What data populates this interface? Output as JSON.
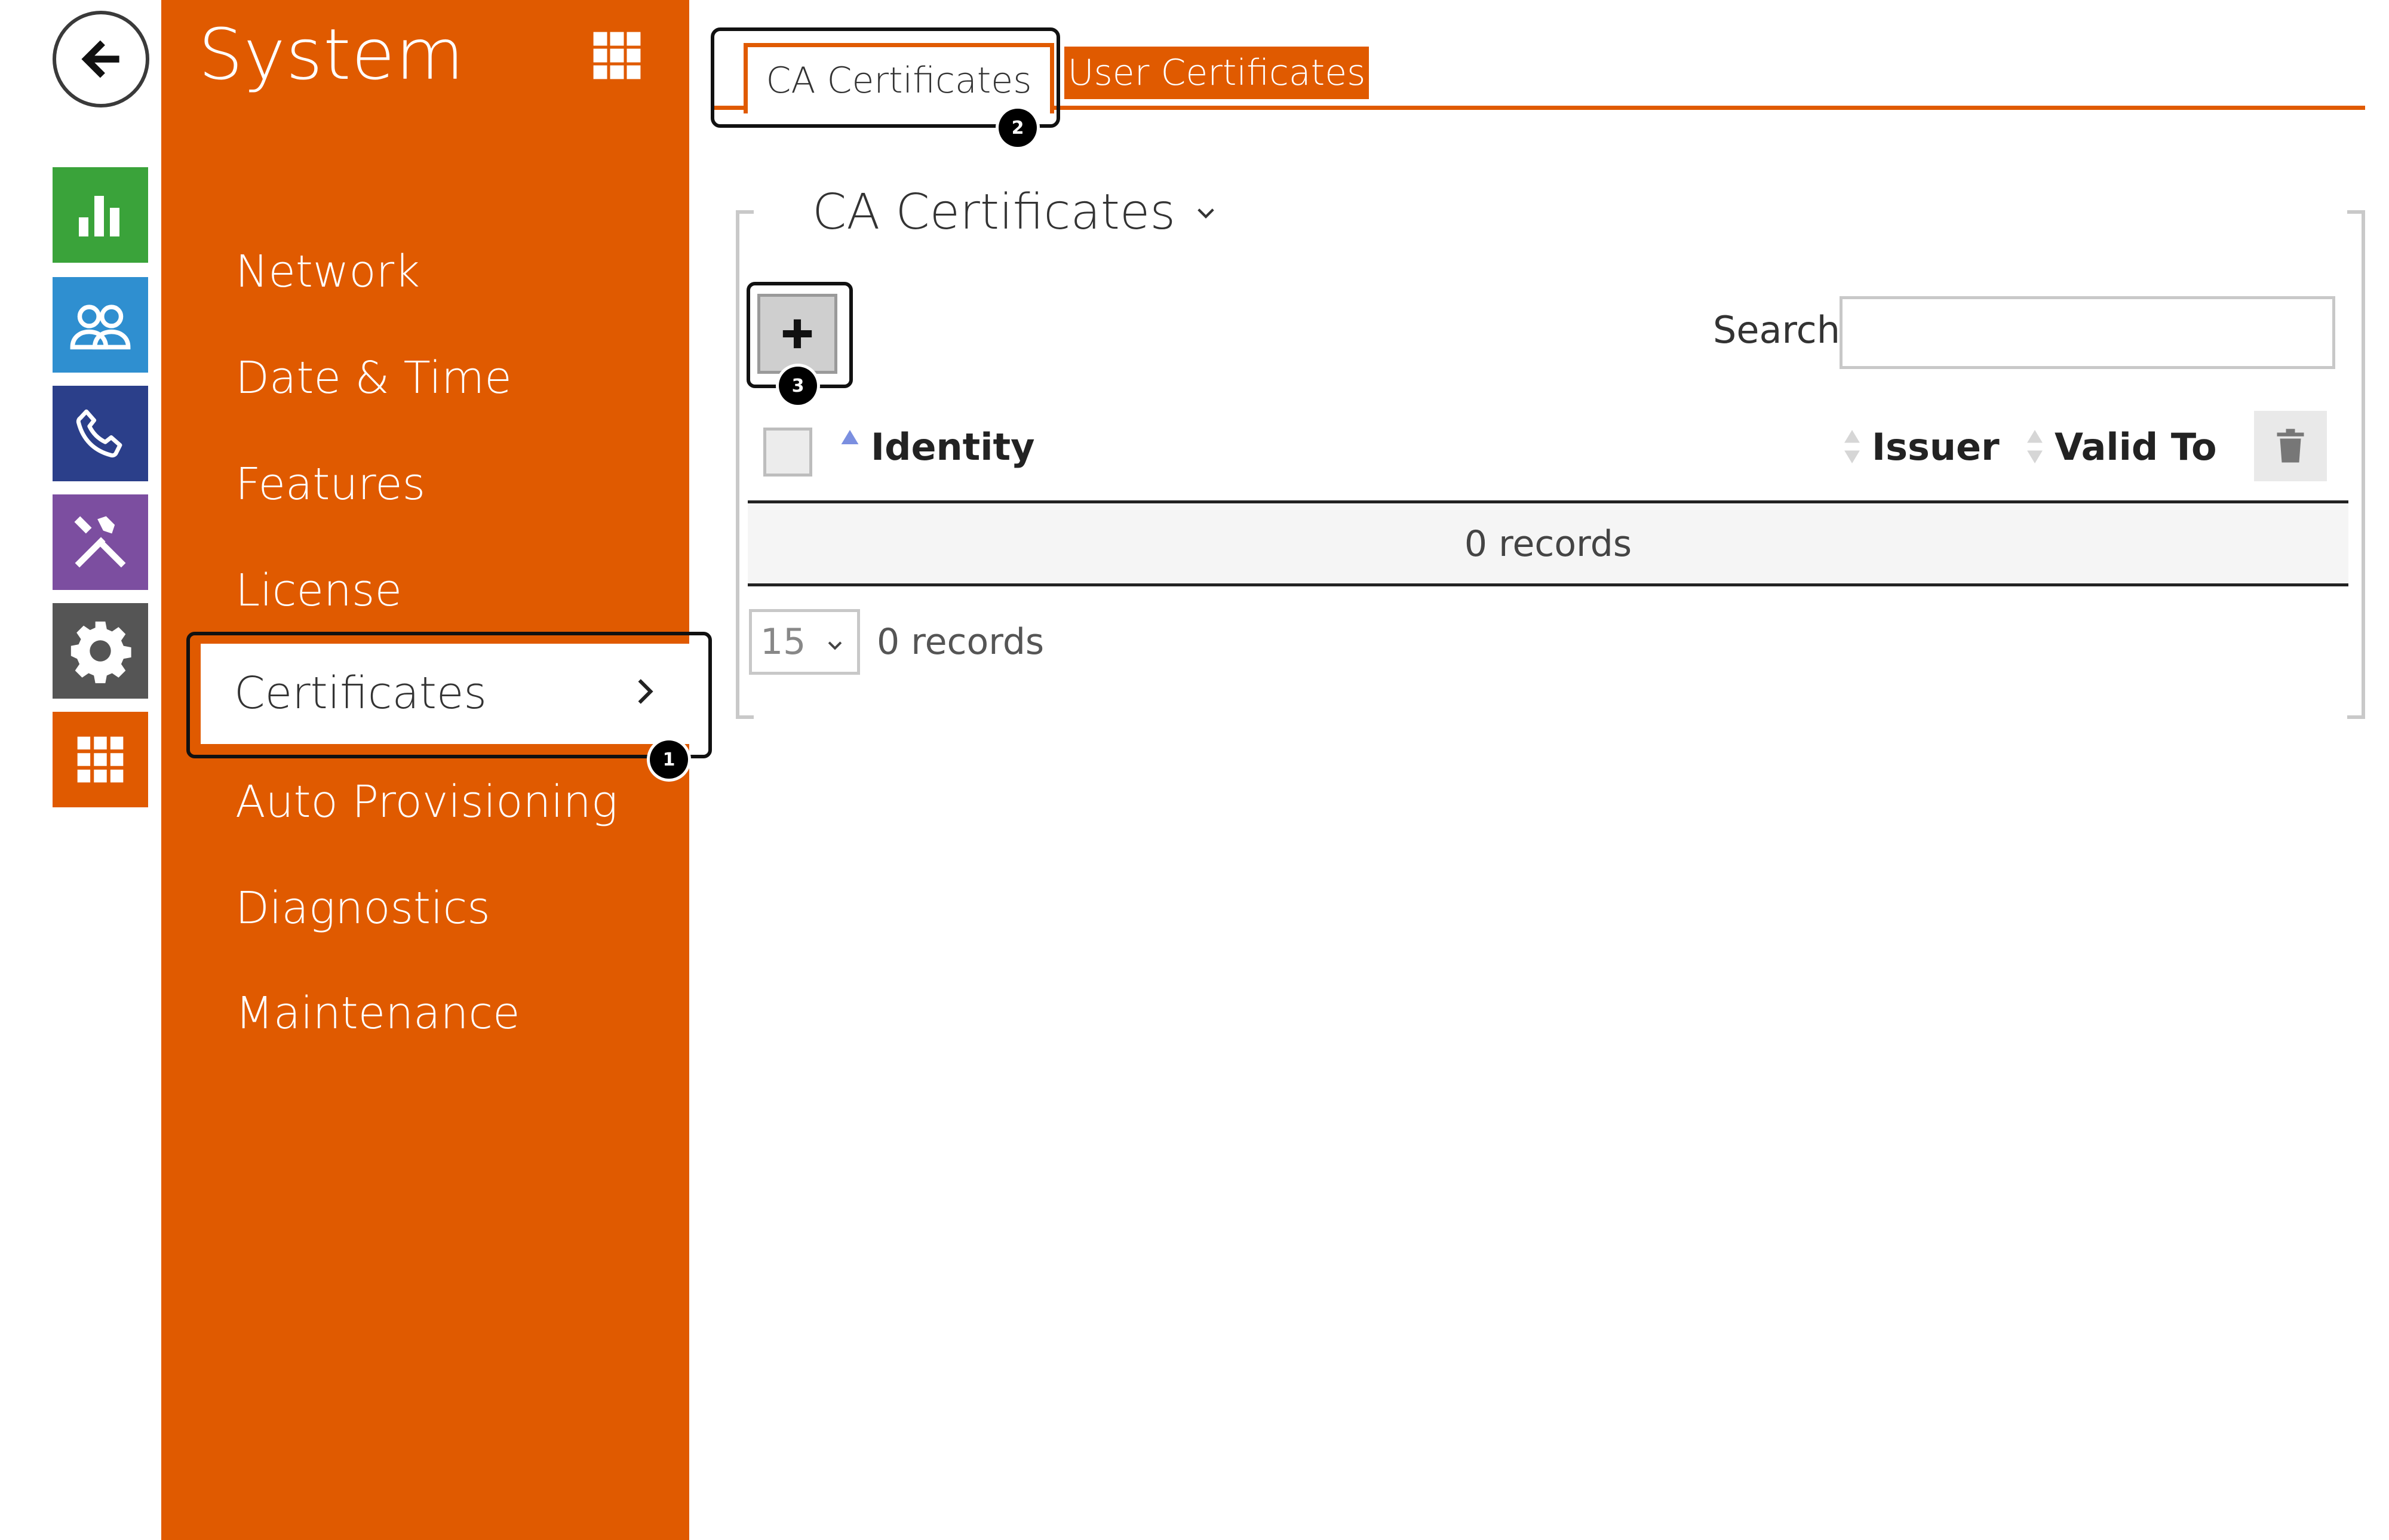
{
  "colors": {
    "accent": "#e05a00",
    "status_green": "#3aa33a",
    "users_blue": "#2f8fd0",
    "phone_navy": "#2b3f8a",
    "tools_purple": "#7c4ea0",
    "settings_gray": "#555555",
    "system_orange": "#e05a00"
  },
  "rail": {
    "back_icon": "arrow-left-icon",
    "tiles": [
      {
        "name": "status",
        "icon": "bar-chart-icon"
      },
      {
        "name": "directory",
        "icon": "users-icon"
      },
      {
        "name": "phone",
        "icon": "phone-icon"
      },
      {
        "name": "hardware",
        "icon": "tools-icon"
      },
      {
        "name": "services",
        "icon": "gear-icon"
      },
      {
        "name": "system",
        "icon": "grid-icon"
      }
    ]
  },
  "sidebar": {
    "title": "System",
    "items": [
      {
        "label": "Network"
      },
      {
        "label": "Date & Time"
      },
      {
        "label": "Features"
      },
      {
        "label": "License"
      },
      {
        "label": "Certificates",
        "active": true
      },
      {
        "label": "Auto Provisioning"
      },
      {
        "label": "Diagnostics"
      },
      {
        "label": "Maintenance"
      }
    ]
  },
  "markers": [
    "1",
    "2",
    "3"
  ],
  "tabs": [
    {
      "label": "CA Certificates",
      "active": true
    },
    {
      "label": "User Certificates",
      "active": false
    }
  ],
  "panel": {
    "title": "CA Certificates",
    "search_label": "Search",
    "search_value": "",
    "columns": [
      "Identity",
      "Issuer",
      "Valid To"
    ],
    "empty_text": "0 records",
    "page_size": "15",
    "footer_count": "0 records"
  }
}
